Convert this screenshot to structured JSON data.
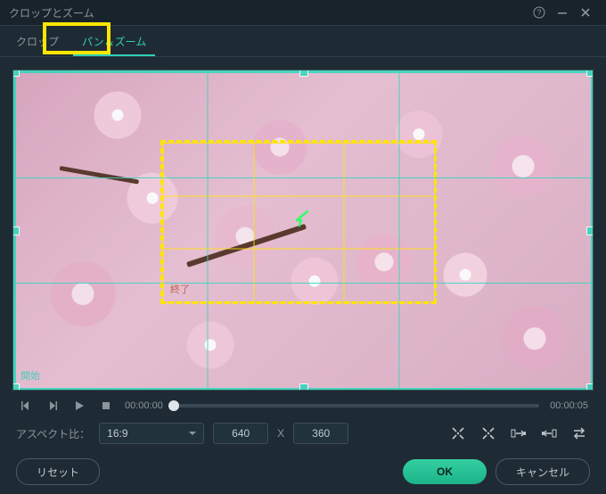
{
  "window": {
    "title": "クロップとズーム"
  },
  "tabs": {
    "crop": "クロップ",
    "panzoom": "パン＆ズーム"
  },
  "preview": {
    "start_label": "開始",
    "end_label": "終了"
  },
  "playback": {
    "current": "00:00:00",
    "duration": "00:00:05"
  },
  "aspect": {
    "label": "アスペクト比：",
    "selected": "16:9",
    "width": "640",
    "x": "X",
    "height": "360"
  },
  "buttons": {
    "reset": "リセット",
    "ok": "OK",
    "cancel": "キャンセル"
  }
}
